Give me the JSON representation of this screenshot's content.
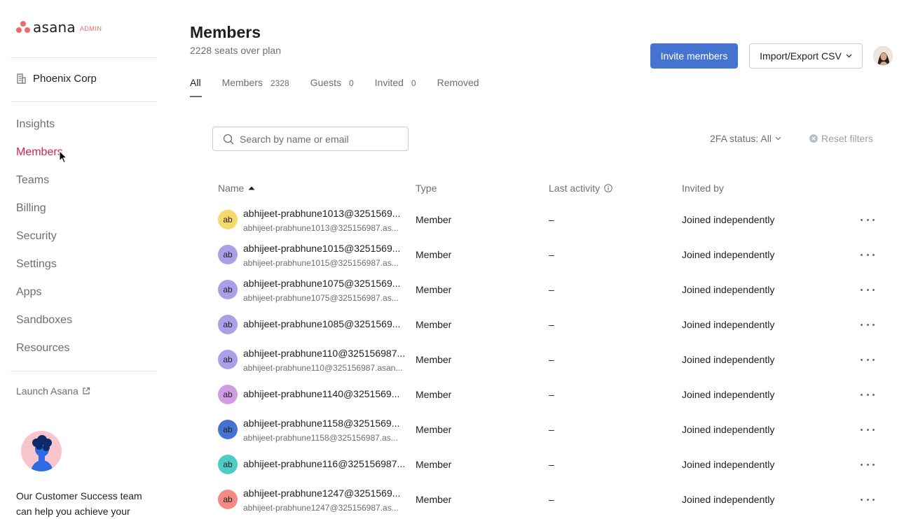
{
  "brand": {
    "wordmark": "asana",
    "suffix": "ADMIN",
    "color": "#f06a6a"
  },
  "sidebar": {
    "org_name": "Phoenix Corp",
    "items": [
      {
        "label": "Insights",
        "active": false
      },
      {
        "label": "Members",
        "active": true
      },
      {
        "label": "Teams",
        "active": false
      },
      {
        "label": "Billing",
        "active": false
      },
      {
        "label": "Security",
        "active": false
      },
      {
        "label": "Settings",
        "active": false
      },
      {
        "label": "Apps",
        "active": false
      },
      {
        "label": "Sandboxes",
        "active": false
      },
      {
        "label": "Resources",
        "active": false
      }
    ],
    "launch_label": "Launch Asana",
    "cs_text": "Our Customer Success team can help you achieve your"
  },
  "header": {
    "title": "Members",
    "subtitle": "2228 seats over plan",
    "invite_label": "Invite members",
    "import_label": "Import/Export CSV"
  },
  "tabs": [
    {
      "label": "All",
      "count": ""
    },
    {
      "label": "Members",
      "count": "2328"
    },
    {
      "label": "Guests",
      "count": "0"
    },
    {
      "label": "Invited",
      "count": "0"
    },
    {
      "label": "Removed",
      "count": ""
    }
  ],
  "toolbar": {
    "search_placeholder": "Search by name or email",
    "twofa_label": "2FA status: All",
    "reset_label": "Reset filters"
  },
  "table": {
    "columns": [
      "Name",
      "Type",
      "Last activity",
      "Invited by"
    ],
    "rows": [
      {
        "initials": "ab",
        "avatar_color": "#f6d86b",
        "name": "abhijeet-prabhune1013@3251569...",
        "email": "abhijeet-prabhune1013@325156987.as...",
        "type": "Member",
        "activity": "–",
        "invited": "Joined independently"
      },
      {
        "initials": "ab",
        "avatar_color": "#aba0e8",
        "name": "abhijeet-prabhune1015@3251569...",
        "email": "abhijeet-prabhune1015@325156987.as...",
        "type": "Member",
        "activity": "–",
        "invited": "Joined independently"
      },
      {
        "initials": "ab",
        "avatar_color": "#aba0e8",
        "name": "abhijeet-prabhune1075@3251569...",
        "email": "abhijeet-prabhune1075@325156987.as...",
        "type": "Member",
        "activity": "–",
        "invited": "Joined independently"
      },
      {
        "initials": "ab",
        "avatar_color": "#aba0e8",
        "name": "abhijeet-prabhune1085@3251569...",
        "email": "",
        "type": "Member",
        "activity": "–",
        "invited": "Joined independently"
      },
      {
        "initials": "ab",
        "avatar_color": "#aba0e8",
        "name": "abhijeet-prabhune110@325156987...",
        "email": "abhijeet-prabhune110@325156987.asan...",
        "type": "Member",
        "activity": "–",
        "invited": "Joined independently"
      },
      {
        "initials": "ab",
        "avatar_color": "#d39be3",
        "name": "abhijeet-prabhune1140@3251569...",
        "email": "",
        "type": "Member",
        "activity": "–",
        "invited": "Joined independently"
      },
      {
        "initials": "ab",
        "avatar_color": "#4573d2",
        "name": "abhijeet-prabhune1158@3251569...",
        "email": "abhijeet-prabhune1158@325156987.as...",
        "type": "Member",
        "activity": "–",
        "invited": "Joined independently"
      },
      {
        "initials": "ab",
        "avatar_color": "#4ecbc4",
        "name": "abhijeet-prabhune116@325156987...",
        "email": "",
        "type": "Member",
        "activity": "–",
        "invited": "Joined independently"
      },
      {
        "initials": "ab",
        "avatar_color": "#f28b82",
        "name": "abhijeet-prabhune1247@3251569...",
        "email": "abhijeet-prabhune1247@325156987.as...",
        "type": "Member",
        "activity": "–",
        "invited": "Joined independently"
      }
    ]
  }
}
